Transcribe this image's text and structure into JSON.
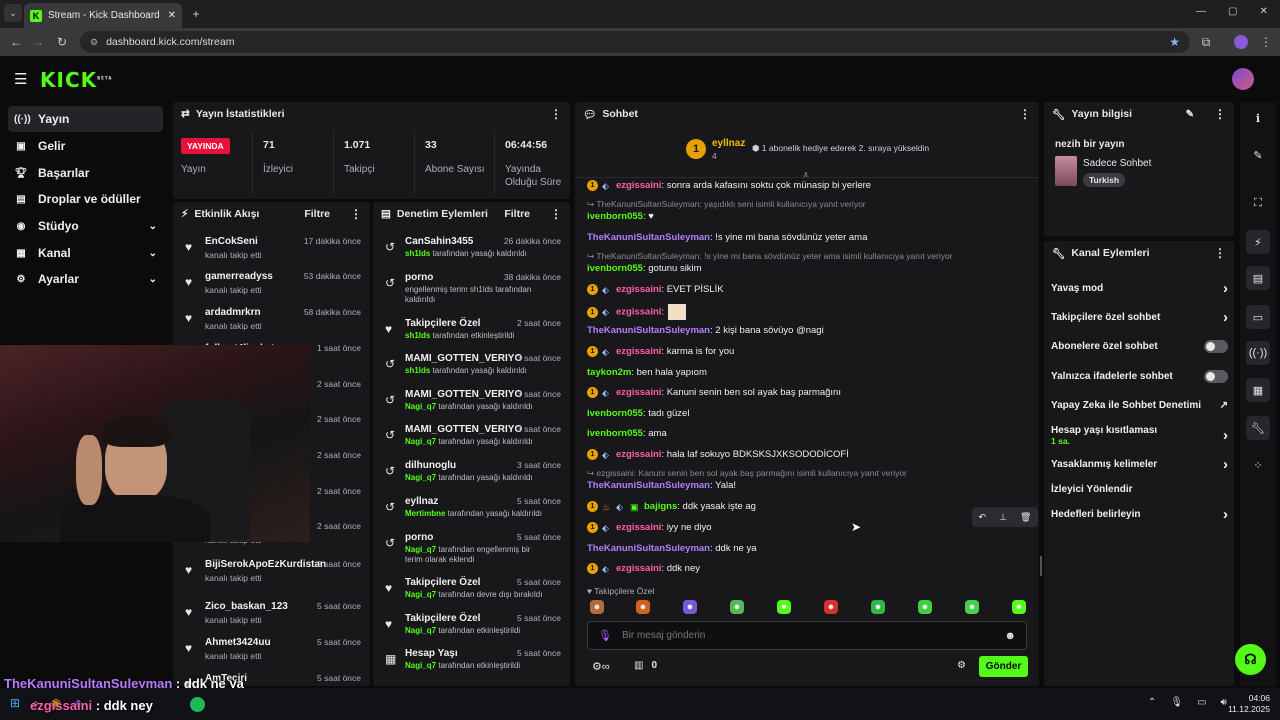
{
  "browser": {
    "tab_title": "Stream - Kick Dashboard",
    "url": "dashboard.kick.com/stream",
    "new_tab": "+",
    "window_controls": [
      "—",
      "▢",
      "✕"
    ]
  },
  "header": {
    "logo": "KICK",
    "beta": "BETA"
  },
  "nav": {
    "items": [
      {
        "label": "Yayın",
        "icon": "broadcast-icon"
      },
      {
        "label": "Gelir",
        "icon": "money-icon"
      },
      {
        "label": "Başarılar",
        "icon": "trophy-icon"
      },
      {
        "label": "Droplar ve ödüller",
        "icon": "gift-icon"
      },
      {
        "label": "Stüdyo",
        "icon": "studio-icon"
      },
      {
        "label": "Kanal",
        "icon": "channel-icon"
      },
      {
        "label": "Ayarlar",
        "icon": "gear-icon"
      }
    ]
  },
  "stats": {
    "title": "Yayın İstatistikleri",
    "live_badge": "YAYINDA",
    "live_label": "Yayın",
    "items": [
      {
        "value": "71",
        "label": "İzleyici"
      },
      {
        "value": "1.071",
        "label": "Takipçi"
      },
      {
        "value": "33",
        "label": "Abone Sayısı"
      },
      {
        "value": "06:44:56",
        "label": "Yayında Olduğu Süre"
      }
    ]
  },
  "activity": {
    "title": "Etkinlik Akışı",
    "filter": "Filtre",
    "items": [
      {
        "name": "EnCokSeni",
        "sub": "kanalı takip etti",
        "time": "17 dakika önce"
      },
      {
        "name": "gamerreadyss",
        "sub": "kanalı takip etti",
        "time": "53 dakika önce"
      },
      {
        "name": "ardadmrkrn",
        "sub": "kanalı takip etti",
        "time": "58 dakika önce"
      },
      {
        "name": "fullmet4ljacket",
        "sub": "",
        "time": "1 saat önce"
      },
      {
        "name": "",
        "sub": "",
        "time": "2 saat önce"
      },
      {
        "name": "",
        "sub": "",
        "time": "2 saat önce"
      },
      {
        "name": "",
        "sub": "",
        "time": "2 saat önce"
      },
      {
        "name": "",
        "sub": "",
        "time": "2 saat önce"
      },
      {
        "name": "",
        "sub": "kanalı takip etti",
        "time": "2 saat önce"
      },
      {
        "name": "BijiSerokApoEzKurdistan",
        "sub": "kanalı takip etti",
        "time": "3 saat önce"
      },
      {
        "name": "Zico_baskan_123",
        "sub": "kanalı takip etti",
        "time": "5 saat önce"
      },
      {
        "name": "Ahmet3424uu",
        "sub": "kanalı takip etti",
        "time": "5 saat önce"
      },
      {
        "name": "AmTeciri",
        "sub": "",
        "time": "5 saat önce"
      }
    ]
  },
  "moderation": {
    "title": "Denetim Eylemleri",
    "filter": "Filtre",
    "items": [
      {
        "name": "CanSahin3455",
        "actor": "sh1lds",
        "text": "tarafından yasağı kaldırıldı",
        "time": "26 dakika önce",
        "icon": "undo-icon"
      },
      {
        "name": "porno",
        "actor": "",
        "text": "engellenmiş terim sh1lds tarafından kaldırıldı",
        "time": "38 dakika önce",
        "icon": "undo-icon"
      },
      {
        "name": "Takipçilere Özel",
        "actor": "sh1lds",
        "text": "tarafından etkinleştirildi",
        "time": "2 saat önce",
        "icon": "heart-icon"
      },
      {
        "name": "MAMI_GOTTEN_VERIYO",
        "actor": "sh1lds",
        "text": "tarafından yasağı kaldırıldı",
        "time": "3 saat önce",
        "icon": "undo-icon"
      },
      {
        "name": "MAMI_GOTTEN_VERIYO",
        "actor": "Nagi_q7",
        "text": "tarafından yasağı kaldırıldı",
        "time": "3 saat önce",
        "icon": "undo-icon"
      },
      {
        "name": "MAMI_GOTTEN_VERIYO",
        "actor": "Nagi_q7",
        "text": "tarafından yasağı kaldırıldı",
        "time": "3 saat önce",
        "icon": "undo-icon"
      },
      {
        "name": "dilhunoglu",
        "actor": "Nagi_q7",
        "text": "tarafından yasağı kaldırıldı",
        "time": "3 saat önce",
        "icon": "undo-icon"
      },
      {
        "name": "eyllnaz",
        "actor": "Mertimbne",
        "text": "tarafından yasağı kaldırıldı",
        "time": "5 saat önce",
        "icon": "undo-icon"
      },
      {
        "name": "porno",
        "actor": "Nagi_q7",
        "text": "tarafından engellenmiş bir terim olarak eklendi",
        "time": "5 saat önce",
        "icon": "undo-icon"
      },
      {
        "name": "Takipçilere Özel",
        "actor": "Nagi_q7",
        "text": "tarafından devre dışı bırakıldı",
        "time": "5 saat önce",
        "icon": "heart-icon"
      },
      {
        "name": "Takipçilere Özel",
        "actor": "Nagi_q7",
        "text": "tarafından etkinleştirildi",
        "time": "5 saat önce",
        "icon": "heart-icon"
      },
      {
        "name": "Hesap Yaşı",
        "actor": "Nagi_q7",
        "text": "tarafından etkinleştirildi",
        "time": "5 saat önce",
        "icon": "calendar-icon"
      }
    ]
  },
  "chat": {
    "title": "Sohbet",
    "pinned": {
      "user": "eyllnaz",
      "count": "4",
      "text": "1 abonelik hediye ederek 2. sıraya yükseldin"
    },
    "messages": [
      {
        "type": "msg",
        "user": "ezgissaini",
        "color": "pink",
        "text": ": sonra arda kafasını soktu çok münasip bi yerlere",
        "badges": 2
      },
      {
        "type": "reply",
        "text": "TheKanuniSultanSuleyman: yaşıdıklı seni isimli kullanıcıya yanıt veriyor"
      },
      {
        "type": "msg",
        "user": "ivenborn055",
        "color": "green",
        "text": ": ♥",
        "badges": 0
      },
      {
        "type": "msg",
        "user": "TheKanuniSultanSuleyman",
        "color": "purple",
        "text": ": !s yine mi bana sövdünüz yeter ama",
        "badges": 0
      },
      {
        "type": "reply",
        "text": "TheKanuniSultanSuleyman: !s yine mi bana sövdünüz yeter ama isimli kullanıcıya yanıt veriyor"
      },
      {
        "type": "msg",
        "user": "ivenborn055",
        "color": "green",
        "text": ": gotunu sikim",
        "badges": 0
      },
      {
        "type": "msg",
        "user": "ezgissaini",
        "color": "pink",
        "text": ": EVET PİSLİK",
        "badges": 2
      },
      {
        "type": "msg",
        "user": "ezgissaini",
        "color": "pink",
        "text": ":",
        "badges": 2,
        "emote": true
      },
      {
        "type": "msg",
        "user": "TheKanuniSultanSuleyman",
        "color": "purple",
        "text": ": 2 kişi bana sövüyo @nagi",
        "badges": 0
      },
      {
        "type": "msg",
        "user": "ezgissaini",
        "color": "pink",
        "text": ": karma is for you",
        "badges": 2
      },
      {
        "type": "msg",
        "user": "taykon2m",
        "color": "green",
        "text": ": ben hala yapıom",
        "badges": 0
      },
      {
        "type": "msg",
        "user": "ezgissaini",
        "color": "pink",
        "text": ": Kanuni senin ben sol ayak baş parmağını",
        "badges": 2
      },
      {
        "type": "msg",
        "user": "ivenborn055",
        "color": "green",
        "text": ": tadı güzel",
        "badges": 0
      },
      {
        "type": "msg",
        "user": "ivenborn055",
        "color": "green",
        "text": ": ama",
        "badges": 0
      },
      {
        "type": "msg",
        "user": "ezgissaini",
        "color": "pink",
        "text": ": hala laf sokuyo BDKSKSJXKSODODİCOFİ",
        "badges": 2
      },
      {
        "type": "reply",
        "text": "ezgissaini: Kanuni senin ben sol ayak baş parmağını isimli kullanıcıya yanıt veriyor"
      },
      {
        "type": "msg",
        "user": "TheKanuniSultanSuleyman",
        "color": "purple",
        "text": ": Yala!",
        "badges": 0
      },
      {
        "type": "msg",
        "user": "bajigns",
        "color": "green",
        "text": ": ddk yasak işte ag",
        "badges": 3
      },
      {
        "type": "msg",
        "user": "ezgissaini",
        "color": "pink",
        "text": ": iyy ne diyo",
        "badges": 2
      },
      {
        "type": "msg",
        "user": "TheKanuniSultanSuleyman",
        "color": "purple",
        "text": ": ddk ne ya",
        "badges": 0
      },
      {
        "type": "msg",
        "user": "ezgissaini",
        "color": "pink",
        "text": ": ddk ney",
        "badges": 2
      }
    ],
    "followers_only_label": "Takipçilere Özel",
    "input_placeholder": "Bir mesaj gönderin",
    "points": "0",
    "send": "Gönder"
  },
  "stream_info": {
    "title": "Yayın bilgisi",
    "stream_title": "nezih bir yayın",
    "category": "Sadece Sohbet",
    "tag": "Turkish"
  },
  "channel_actions": {
    "title": "Kanal Eylemleri",
    "items": [
      {
        "label": "Yavaş mod",
        "kind": "chevron"
      },
      {
        "label": "Takipçilere özel sohbet",
        "kind": "chevron"
      },
      {
        "label": "Abonelere özel sohbet",
        "kind": "toggle"
      },
      {
        "label": "Yalnızca ifadelerle sohbet",
        "kind": "toggle"
      },
      {
        "label": "Yapay Zeka ile Sohbet Denetimi",
        "kind": "external"
      },
      {
        "label": "Hesap yaşı kısıtlaması",
        "sub": "1 sa.",
        "kind": "chevron"
      },
      {
        "label": "Yasaklanmış kelimeler",
        "kind": "chevron"
      },
      {
        "label": "İzleyici Yönlendir",
        "kind": "none"
      },
      {
        "label": "Hedefleri belirleyin",
        "kind": "chevron"
      }
    ]
  },
  "overlay": {
    "line1_user": "TheKanuniSultanSuleyman",
    "line1_text": " : ddk ne ya",
    "line2_user": "ezgissaini",
    "line2_text": " : ddk ney"
  },
  "taskbar": {
    "time": "04:06",
    "date": "11.12.2025"
  },
  "colors": {
    "accent": "#53fc18",
    "panel": "#18181b",
    "bg": "#0b0b0c"
  }
}
